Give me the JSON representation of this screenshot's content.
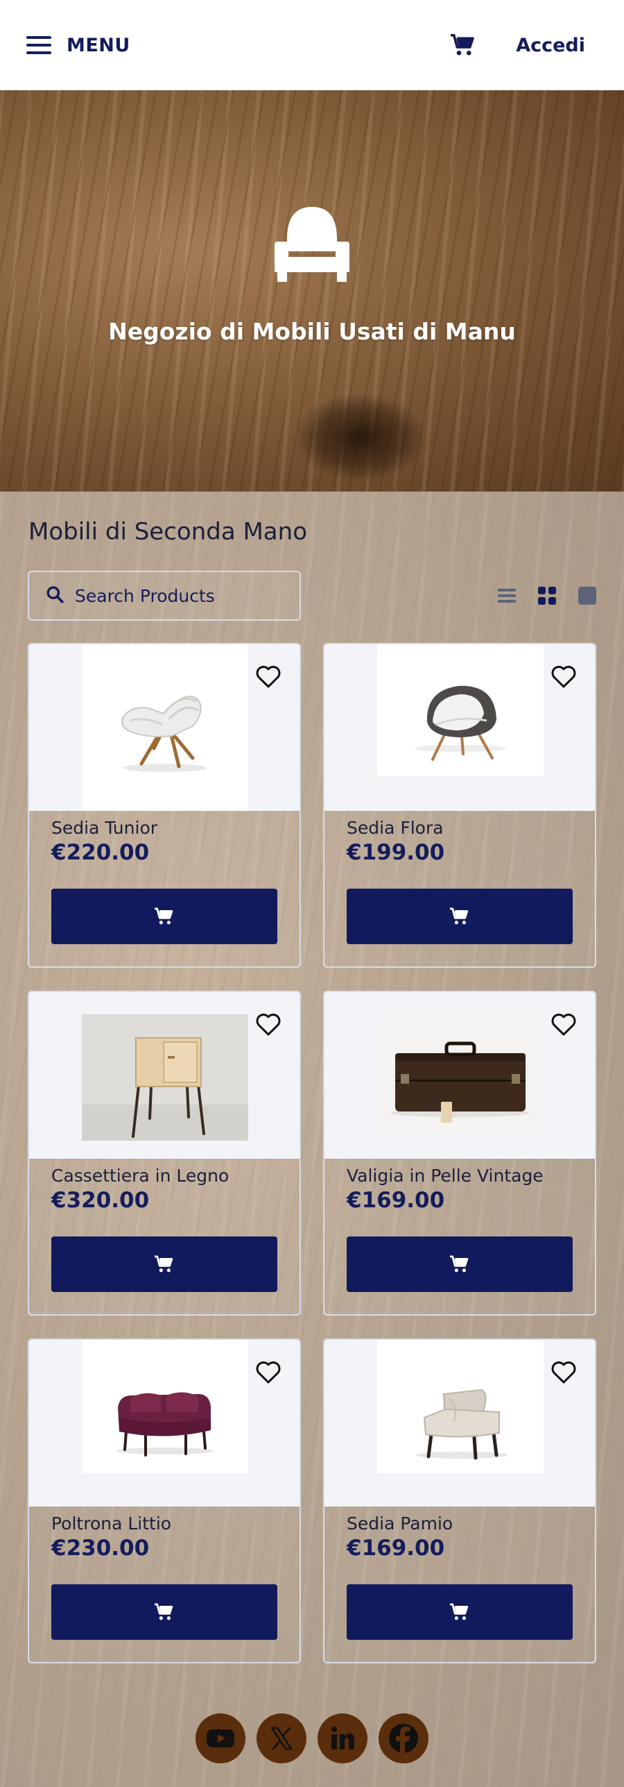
{
  "header": {
    "menu_label": "MENU",
    "login_label": "Accedi"
  },
  "hero": {
    "title": "Negozio di Mobili Usati di Manu"
  },
  "main": {
    "section_title": "Mobili di Seconda Mano",
    "search_placeholder": "Search Products"
  },
  "products": [
    {
      "name": "Sedia Tunior",
      "price": "€220.00"
    },
    {
      "name": "Sedia Flora",
      "price": "€199.00"
    },
    {
      "name": "Cassettiera in Legno",
      "price": "€320.00"
    },
    {
      "name": "Valigia in Pelle Vintage",
      "price": "€169.00"
    },
    {
      "name": "Poltrona Littio",
      "price": "€230.00"
    },
    {
      "name": "Sedia Pamio",
      "price": "€169.00"
    }
  ],
  "colors": {
    "brand_navy": "#101a5c",
    "social_brown": "#5a2d0c"
  },
  "icons": [
    "menu-icon",
    "cart-icon",
    "chair-logo-icon",
    "search-icon",
    "list-view-icon",
    "grid-view-icon",
    "single-view-icon",
    "heart-icon",
    "youtube-icon",
    "x-icon",
    "linkedin-icon",
    "facebook-icon"
  ]
}
